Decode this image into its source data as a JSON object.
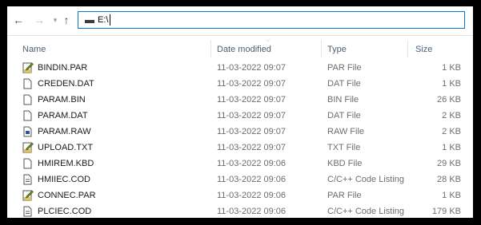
{
  "address": {
    "path": "E:\\"
  },
  "columns": {
    "name": "Name",
    "date": "Date modified",
    "type": "Type",
    "size": "Size"
  },
  "files": [
    {
      "name": "BINDIN.PAR",
      "date": "11-03-2022 09:07",
      "type": "PAR File",
      "size": "1 KB",
      "icon": "edit-document-icon"
    },
    {
      "name": "CREDEN.DAT",
      "date": "11-03-2022 09:07",
      "type": "DAT File",
      "size": "1 KB",
      "icon": "blank-file-icon"
    },
    {
      "name": "PARAM.BIN",
      "date": "11-03-2022 09:07",
      "type": "BIN File",
      "size": "26 KB",
      "icon": "blank-file-icon"
    },
    {
      "name": "PARAM.DAT",
      "date": "11-03-2022 09:07",
      "type": "DAT File",
      "size": "2 KB",
      "icon": "blank-file-icon"
    },
    {
      "name": "PARAM.RAW",
      "date": "11-03-2022 09:07",
      "type": "RAW File",
      "size": "2 KB",
      "icon": "image-file-icon"
    },
    {
      "name": "UPLOAD.TXT",
      "date": "11-03-2022 09:07",
      "type": "TXT File",
      "size": "1 KB",
      "icon": "edit-document-icon"
    },
    {
      "name": "HMIREM.KBD",
      "date": "11-03-2022 09:06",
      "type": "KBD File",
      "size": "29 KB",
      "icon": "blank-file-icon"
    },
    {
      "name": "HMIIEC.COD",
      "date": "11-03-2022 09:06",
      "type": "C/C++ Code Listing",
      "size": "28 KB",
      "icon": "code-file-icon"
    },
    {
      "name": "CONNEC.PAR",
      "date": "11-03-2022 09:06",
      "type": "PAR File",
      "size": "1 KB",
      "icon": "edit-document-icon"
    },
    {
      "name": "PLCIEC.COD",
      "date": "11-03-2022 09:06",
      "type": "C/C++ Code Listing",
      "size": "179 KB",
      "icon": "code-file-icon"
    }
  ]
}
